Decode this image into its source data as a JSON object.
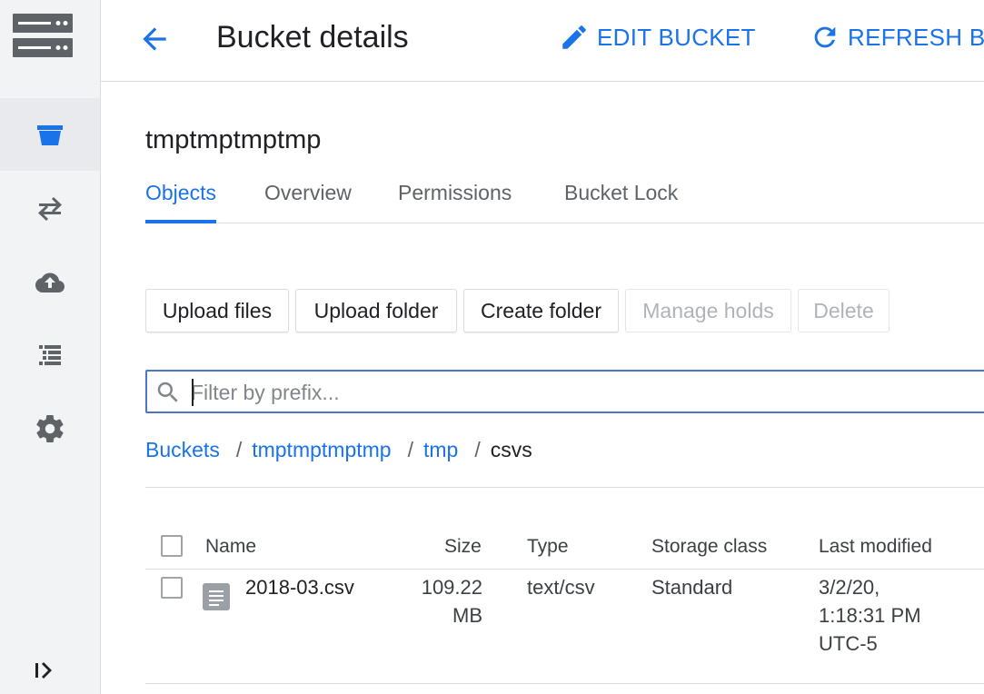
{
  "header": {
    "title": "Bucket details",
    "edit_label": "EDIT BUCKET",
    "refresh_label": "REFRESH BU"
  },
  "bucket": {
    "name": "tmptmptmptmp"
  },
  "tabs": [
    {
      "label": "Objects",
      "active": true
    },
    {
      "label": "Overview",
      "active": false
    },
    {
      "label": "Permissions",
      "active": false
    },
    {
      "label": "Bucket Lock",
      "active": false
    }
  ],
  "toolbar": {
    "upload_files": "Upload files",
    "upload_folder": "Upload folder",
    "create_folder": "Create folder",
    "manage_holds": "Manage holds",
    "delete": "Delete"
  },
  "filter": {
    "placeholder": "Filter by prefix..."
  },
  "breadcrumb": {
    "buckets": "Buckets",
    "bucket": "tmptmptmptmp",
    "folder": "tmp",
    "current": "csvs",
    "separator": "/"
  },
  "table": {
    "columns": {
      "name": "Name",
      "size": "Size",
      "type": "Type",
      "storage_class": "Storage class",
      "last_modified": "Last modified"
    },
    "rows": [
      {
        "name": "2018-03.csv",
        "size_value": "109.22",
        "size_unit": "MB",
        "type": "text/csv",
        "storage_class": "Standard",
        "modified_date": "3/2/20,",
        "modified_time": "1:18:31 PM",
        "modified_tz": "UTC-5"
      }
    ]
  },
  "colors": {
    "accent": "#1a73e8",
    "sidebar_icon": "#5f6368",
    "active_icon": "#1a73e8"
  },
  "icons": {
    "logo": "storage-logo-icon",
    "nav": [
      "bucket-icon",
      "transfer-icon",
      "cloud-upload-icon",
      "list-icon",
      "settings-icon"
    ],
    "expand": "expand-sidebar-icon"
  }
}
